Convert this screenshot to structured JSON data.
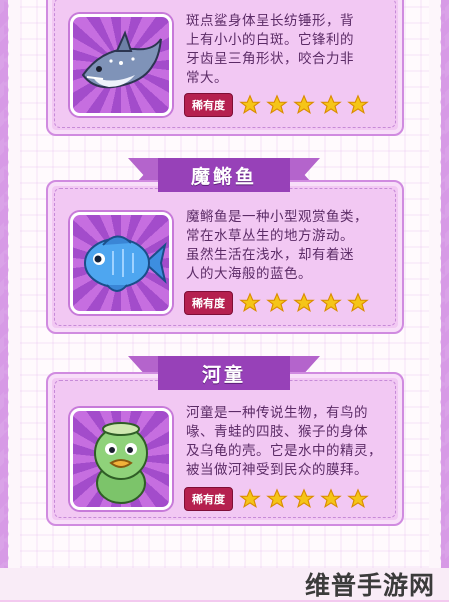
{
  "cards": [
    {
      "id": "shark",
      "title": "",
      "desc_lines": [
        "斑点鲨身体呈长纺锤形，背",
        "上有小小的白斑。它锋利的",
        "牙齿呈三角形状，咬合力非",
        "常大。"
      ],
      "rarity_label": "稀有度",
      "stars": 5,
      "portrait_icon": "shark-icon"
    },
    {
      "id": "fish",
      "title": "魔鳉鱼",
      "desc_lines": [
        "魔鳉鱼是一种小型观赏鱼类，",
        "常在水草丛生的地方游动。",
        "虽然生活在浅水，却有着迷",
        "人的大海般的蓝色。"
      ],
      "rarity_label": "稀有度",
      "stars": 5,
      "portrait_icon": "blue-fish-icon"
    },
    {
      "id": "kappa",
      "title": "河童",
      "desc_lines": [
        "河童是一种传说生物，有鸟的",
        "喙、青蛙的四肢、猴子的身体",
        "及乌龟的壳。它是水中的精灵，",
        "被当做河神受到民众的膜拜。"
      ],
      "rarity_label": "稀有度",
      "stars": 5,
      "portrait_icon": "kappa-icon"
    }
  ],
  "watermark": "维普手游网",
  "colors": {
    "frame": "#d79ae6",
    "card": "#f2c8f3",
    "ribbon": "#9741b8",
    "badge": "#b5204f",
    "star": "#f5c518"
  }
}
